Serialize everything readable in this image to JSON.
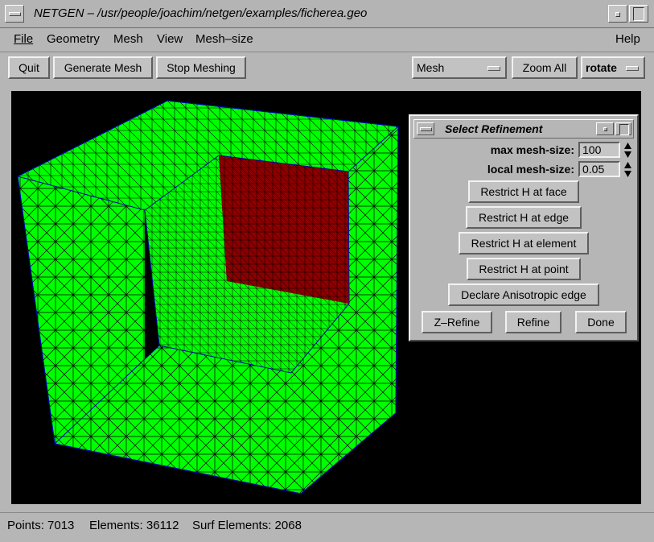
{
  "window": {
    "title": "NETGEN – /usr/people/joachim/netgen/examples/ficherea.geo"
  },
  "menubar": {
    "file": "File",
    "geometry": "Geometry",
    "mesh": "Mesh",
    "view": "View",
    "mesh_size": "Mesh–size",
    "help": "Help"
  },
  "toolbar": {
    "quit": "Quit",
    "generate": "Generate Mesh",
    "stop": "Stop Meshing",
    "view_select": "Mesh",
    "zoom_all": "Zoom All",
    "mode_select": "rotate"
  },
  "dialog": {
    "title": "Select Refinement",
    "max_mesh_size_label": "max mesh-size:",
    "max_mesh_size_value": "100",
    "local_mesh_size_label": "local mesh-size:",
    "local_mesh_size_value": "0.05",
    "restrict_face": "Restrict H at face",
    "restrict_edge": "Restrict H at edge",
    "restrict_element": "Restrict H at element",
    "restrict_point": "Restrict H at point",
    "declare_aniso": "Declare Anisotropic edge",
    "z_refine": "Z–Refine",
    "refine": "Refine",
    "done": "Done"
  },
  "status": {
    "points": "Points: 7013",
    "elements": "Elements: 36112",
    "surf_elements": "Surf Elements: 2068"
  },
  "colors": {
    "mesh_green": "#00ff00",
    "mesh_red": "#8b0000",
    "edge_blue": "#0000aa"
  }
}
